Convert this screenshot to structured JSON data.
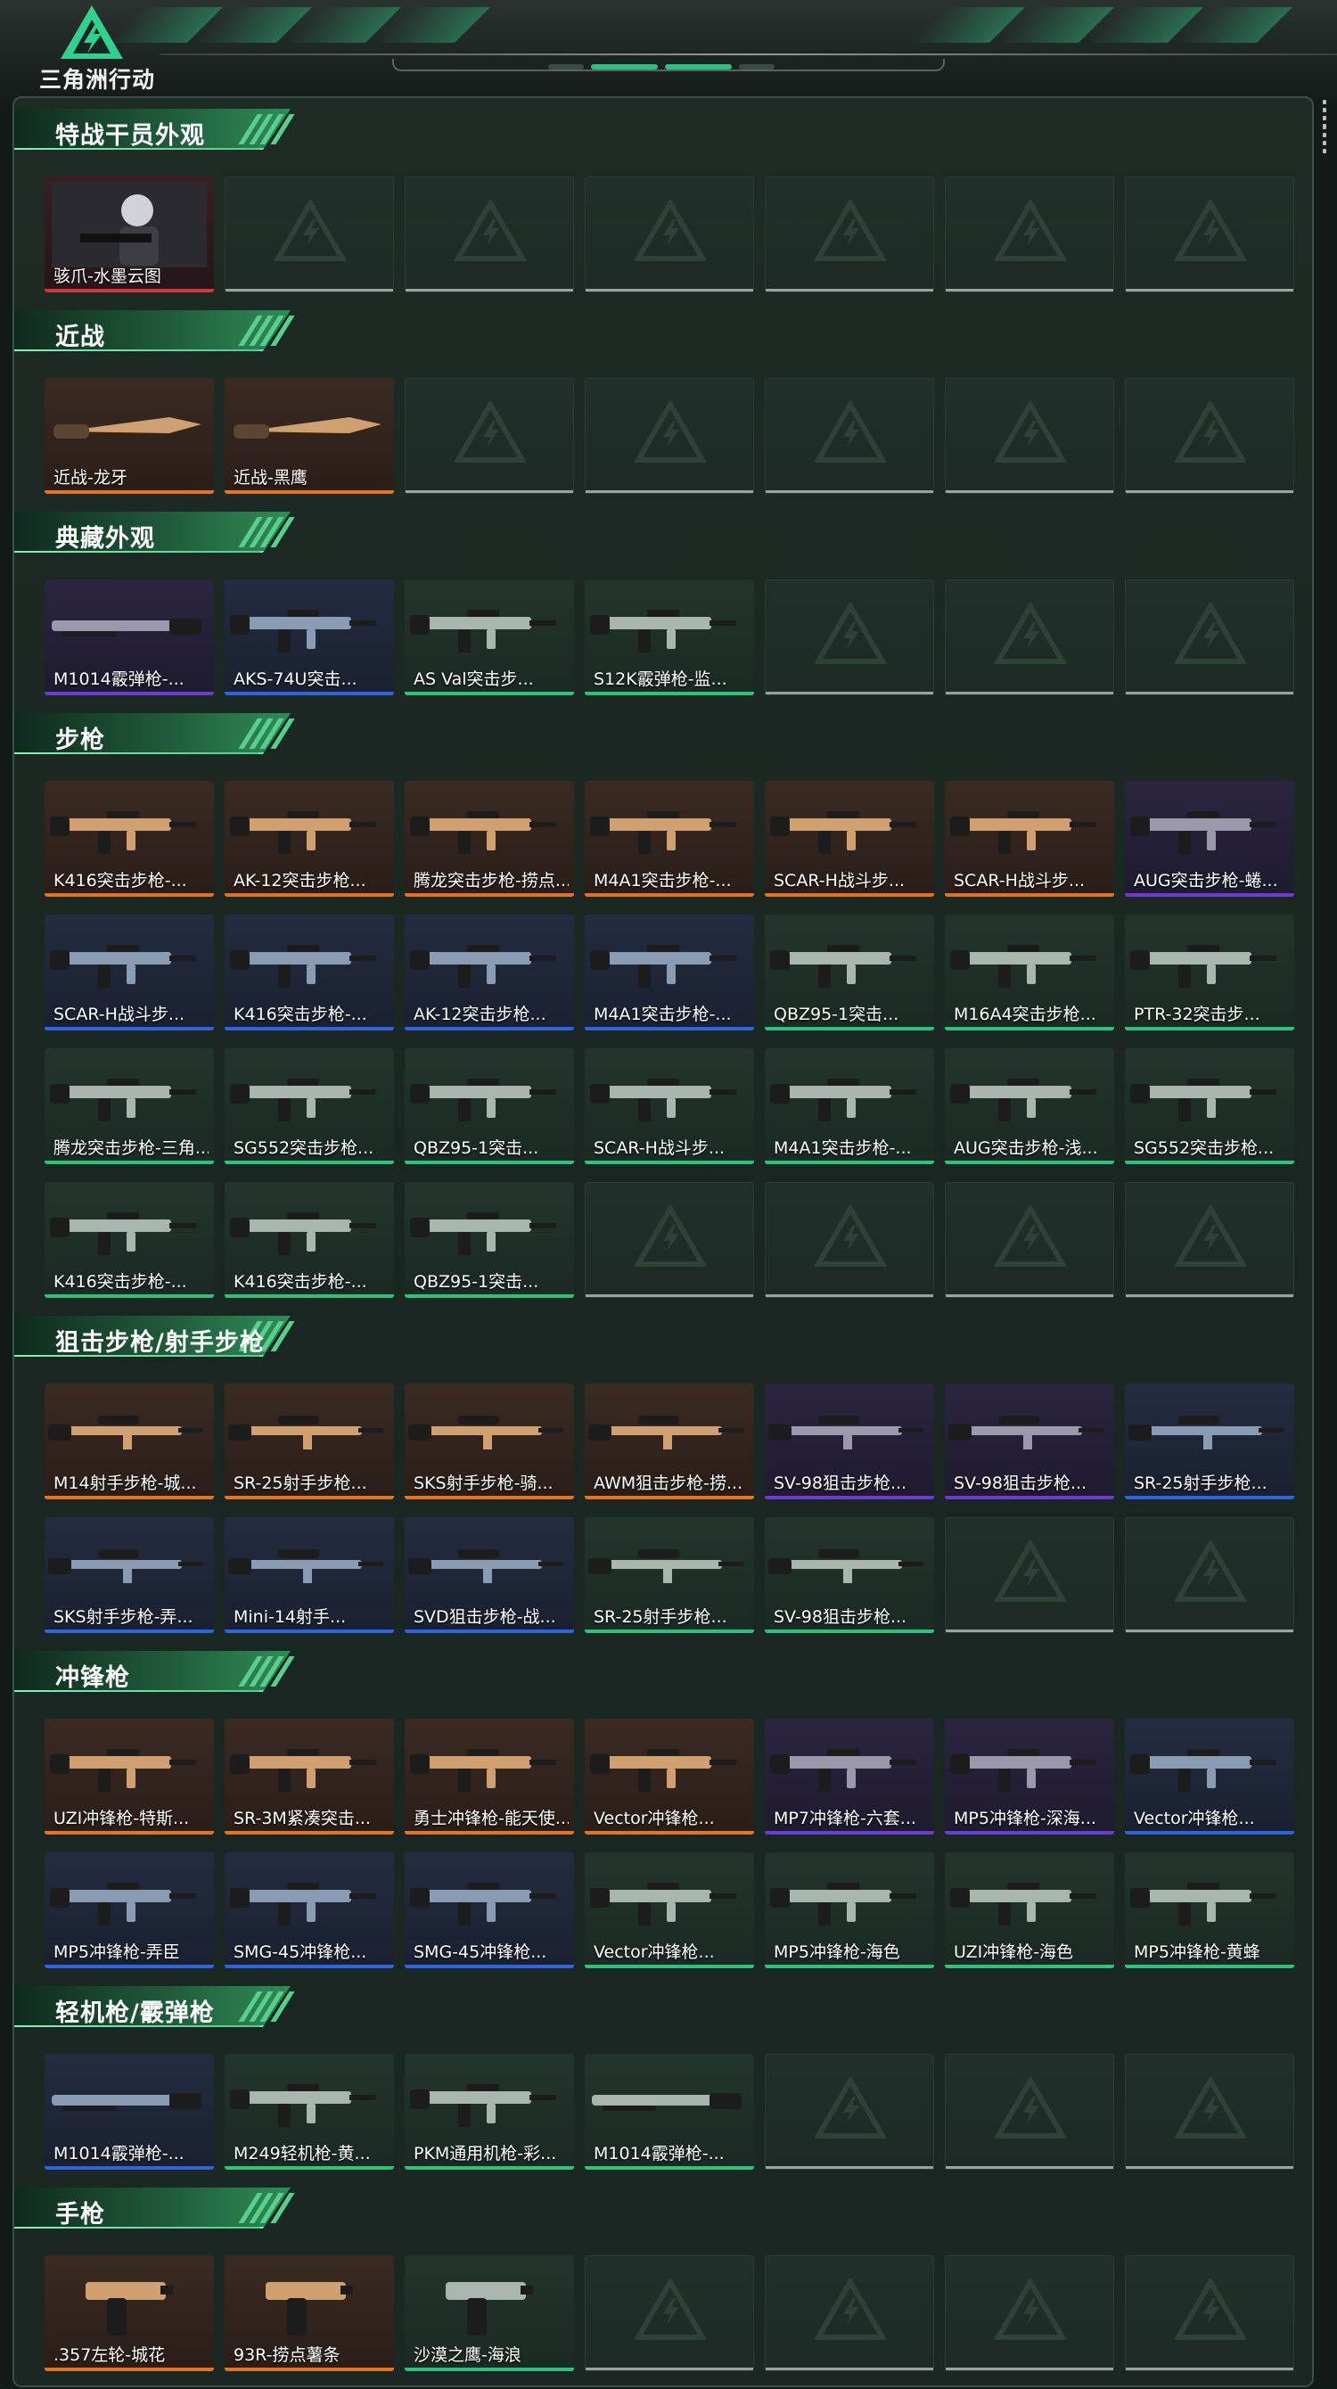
{
  "header": {
    "logo_text": "三角洲行动",
    "active_page": 2
  },
  "colors": {
    "red": "#d8343b",
    "orange": "#e8731e",
    "purple": "#6d3ad6",
    "blue": "#2f64e0",
    "green": "#2cc479",
    "empty": "#9aa39f"
  },
  "slots_per_row": 7,
  "sections": [
    {
      "title": "特战干员外观",
      "rows": [
        [
          {
            "label": "骇爪-水墨云图",
            "tier": "red",
            "icon": "operator-portrait"
          }
        ]
      ]
    },
    {
      "title": "近战",
      "rows": [
        [
          {
            "label": "近战-龙牙",
            "tier": "orange",
            "icon": "knife"
          },
          {
            "label": "近战-黑鹰",
            "tier": "orange",
            "icon": "knife"
          }
        ]
      ]
    },
    {
      "title": "典藏外观",
      "rows": [
        [
          {
            "label": "M1014霰弹枪-...",
            "tier": "purple",
            "icon": "shotgun"
          },
          {
            "label": "AKS-74U突击...",
            "tier": "blue",
            "icon": "rifle"
          },
          {
            "label": "AS Val突击步...",
            "tier": "green",
            "icon": "rifle"
          },
          {
            "label": "S12K霰弹枪-监...",
            "tier": "green",
            "icon": "rifle"
          }
        ]
      ]
    },
    {
      "title": "步枪",
      "rows": [
        [
          {
            "label": "K416突击步枪-...",
            "tier": "orange",
            "icon": "rifle"
          },
          {
            "label": "AK-12突击步枪...",
            "tier": "orange",
            "icon": "rifle"
          },
          {
            "label": "腾龙突击步枪-捞点...",
            "tier": "orange",
            "icon": "rifle"
          },
          {
            "label": "M4A1突击步枪-...",
            "tier": "orange",
            "icon": "rifle"
          },
          {
            "label": "SCAR-H战斗步...",
            "tier": "orange",
            "icon": "rifle"
          },
          {
            "label": "SCAR-H战斗步...",
            "tier": "orange",
            "icon": "rifle"
          },
          {
            "label": "AUG突击步枪-蜷...",
            "tier": "purple",
            "icon": "rifle"
          }
        ],
        [
          {
            "label": "SCAR-H战斗步...",
            "tier": "blue",
            "icon": "rifle"
          },
          {
            "label": "K416突击步枪-...",
            "tier": "blue",
            "icon": "rifle"
          },
          {
            "label": "AK-12突击步枪...",
            "tier": "blue",
            "icon": "rifle"
          },
          {
            "label": "M4A1突击步枪-...",
            "tier": "blue",
            "icon": "rifle"
          },
          {
            "label": "QBZ95-1突击...",
            "tier": "green",
            "icon": "rifle"
          },
          {
            "label": "M16A4突击步枪...",
            "tier": "green",
            "icon": "rifle"
          },
          {
            "label": "PTR-32突击步...",
            "tier": "green",
            "icon": "rifle"
          }
        ],
        [
          {
            "label": "腾龙突击步枪-三角...",
            "tier": "green",
            "icon": "rifle"
          },
          {
            "label": "SG552突击步枪...",
            "tier": "green",
            "icon": "rifle"
          },
          {
            "label": "QBZ95-1突击...",
            "tier": "green",
            "icon": "rifle"
          },
          {
            "label": "SCAR-H战斗步...",
            "tier": "green",
            "icon": "rifle"
          },
          {
            "label": "M4A1突击步枪-...",
            "tier": "green",
            "icon": "rifle"
          },
          {
            "label": "AUG突击步枪-浅...",
            "tier": "green",
            "icon": "rifle"
          },
          {
            "label": "SG552突击步枪...",
            "tier": "green",
            "icon": "rifle"
          }
        ],
        [
          {
            "label": "K416突击步枪-...",
            "tier": "green",
            "icon": "rifle"
          },
          {
            "label": "K416突击步枪-...",
            "tier": "green",
            "icon": "rifle"
          },
          {
            "label": "QBZ95-1突击...",
            "tier": "green",
            "icon": "rifle"
          }
        ]
      ]
    },
    {
      "title": "狙击步枪/射手步枪",
      "rows": [
        [
          {
            "label": "M14射手步枪-城...",
            "tier": "orange",
            "icon": "sniper"
          },
          {
            "label": "SR-25射手步枪...",
            "tier": "orange",
            "icon": "sniper"
          },
          {
            "label": "SKS射手步枪-骑...",
            "tier": "orange",
            "icon": "sniper"
          },
          {
            "label": "AWM狙击步枪-捞...",
            "tier": "orange",
            "icon": "sniper"
          },
          {
            "label": "SV-98狙击步枪...",
            "tier": "purple",
            "icon": "sniper"
          },
          {
            "label": "SV-98狙击步枪...",
            "tier": "purple",
            "icon": "sniper"
          },
          {
            "label": "SR-25射手步枪...",
            "tier": "blue",
            "icon": "sniper"
          }
        ],
        [
          {
            "label": "SKS射手步枪-弄...",
            "tier": "blue",
            "icon": "sniper"
          },
          {
            "label": "Mini-14射手...",
            "tier": "blue",
            "icon": "sniper"
          },
          {
            "label": "SVD狙击步枪-战...",
            "tier": "blue",
            "icon": "sniper"
          },
          {
            "label": "SR-25射手步枪...",
            "tier": "green",
            "icon": "sniper"
          },
          {
            "label": "SV-98狙击步枪...",
            "tier": "green",
            "icon": "sniper"
          }
        ]
      ]
    },
    {
      "title": "冲锋枪",
      "rows": [
        [
          {
            "label": "UZI冲锋枪-特斯...",
            "tier": "orange",
            "icon": "smg"
          },
          {
            "label": "SR-3M紧凑突击...",
            "tier": "orange",
            "icon": "smg"
          },
          {
            "label": "勇士冲锋枪-能天使...",
            "tier": "orange",
            "icon": "smg"
          },
          {
            "label": "Vector冲锋枪...",
            "tier": "orange",
            "icon": "smg"
          },
          {
            "label": "MP7冲锋枪-六套...",
            "tier": "purple",
            "icon": "smg"
          },
          {
            "label": "MP5冲锋枪-深海...",
            "tier": "purple",
            "icon": "smg"
          },
          {
            "label": "Vector冲锋枪...",
            "tier": "blue",
            "icon": "smg"
          }
        ],
        [
          {
            "label": "MP5冲锋枪-弄臣",
            "tier": "blue",
            "icon": "smg"
          },
          {
            "label": "SMG-45冲锋枪...",
            "tier": "blue",
            "icon": "smg"
          },
          {
            "label": "SMG-45冲锋枪...",
            "tier": "blue",
            "icon": "smg"
          },
          {
            "label": "Vector冲锋枪...",
            "tier": "green",
            "icon": "smg"
          },
          {
            "label": "MP5冲锋枪-海色",
            "tier": "green",
            "icon": "smg"
          },
          {
            "label": "UZI冲锋枪-海色",
            "tier": "green",
            "icon": "smg"
          },
          {
            "label": "MP5冲锋枪-黄蜂",
            "tier": "green",
            "icon": "smg"
          }
        ]
      ]
    },
    {
      "title": "轻机枪/霰弹枪",
      "rows": [
        [
          {
            "label": "M1014霰弹枪-...",
            "tier": "blue",
            "icon": "shotgun"
          },
          {
            "label": "M249轻机枪-黄...",
            "tier": "green",
            "icon": "lmg"
          },
          {
            "label": "PKM通用机枪-彩...",
            "tier": "green",
            "icon": "lmg"
          },
          {
            "label": "M1014霰弹枪-...",
            "tier": "green",
            "icon": "shotgun"
          }
        ]
      ]
    },
    {
      "title": "手枪",
      "rows": [
        [
          {
            "label": ".357左轮-城花",
            "tier": "orange",
            "icon": "pistol"
          },
          {
            "label": "93R-捞点薯条",
            "tier": "orange",
            "icon": "pistol"
          },
          {
            "label": "沙漠之鹰-海浪",
            "tier": "green",
            "icon": "pistol"
          }
        ]
      ]
    }
  ]
}
